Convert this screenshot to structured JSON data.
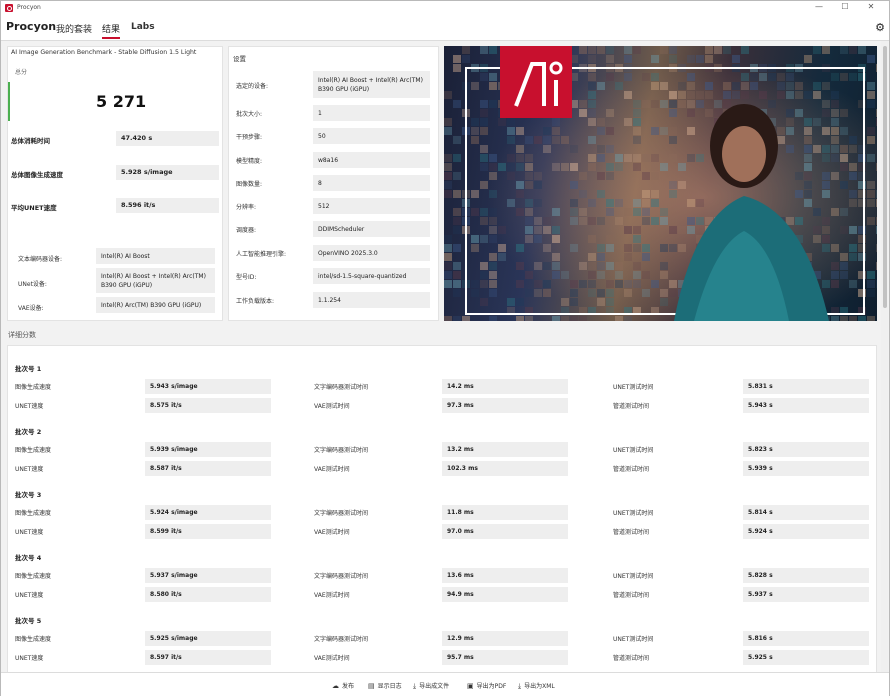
{
  "window": {
    "title": "Procyon",
    "controls": [
      "—",
      "☐",
      "✕"
    ]
  },
  "nav": {
    "brand": "Procyon",
    "tabs": [
      "我的套装",
      "结果",
      "Labs"
    ],
    "active_tab": "结果"
  },
  "summary": {
    "benchmark_name": "AI Image Generation Benchmark - Stable Diffusion 1.5 Light",
    "score_label": "总分",
    "score": "5 271",
    "metrics": [
      {
        "label": "总体消耗时间",
        "value": "47.420 s"
      },
      {
        "label": "总体图像生成速度",
        "value": "5.928 s/image"
      },
      {
        "label": "平均UNET速度",
        "value": "8.596 it/s"
      }
    ],
    "devices": [
      {
        "label": "文本编码器设备:",
        "value": "Intel(R) AI Boost"
      },
      {
        "label": "UNet设备:",
        "value": "Intel(R) AI Boost + Intel(R) Arc(TM) B390 GPU (iGPU)"
      },
      {
        "label": "VAE设备:",
        "value": "Intel(R) Arc(TM) B390 GPU (iGPU)"
      }
    ]
  },
  "settings": {
    "title": "设置",
    "rows": [
      {
        "label": "选定的设备:",
        "value": "Intel(R) AI Boost + Intel(R) Arc(TM) B390 GPU (iGPU)"
      },
      {
        "label": "批次大小:",
        "value": "1"
      },
      {
        "label": "干预步骤:",
        "value": "50"
      },
      {
        "label": "模型精度:",
        "value": "w8a16"
      },
      {
        "label": "图像数量:",
        "value": "8"
      },
      {
        "label": "分辨率:",
        "value": "512"
      },
      {
        "label": "调度器:",
        "value": "DDIMScheduler"
      },
      {
        "label": "人工智能推理引擎:",
        "value": "OpenVINO 2025.3.0"
      },
      {
        "label": "型号ID:",
        "value": "intel/sd-1.5-square-quantized"
      },
      {
        "label": "工作负载版本:",
        "value": "1.1.254"
      }
    ]
  },
  "hero": {
    "logo_text": "AI"
  },
  "detailed": {
    "title": "详细分数",
    "col_labels": [
      [
        "图像生成速度",
        "UNET速度"
      ],
      [
        "文字编码器测试时间",
        "VAE测试时间"
      ],
      [
        "UNET测试时间",
        "管道测试时间"
      ]
    ],
    "batches": [
      {
        "name": "批次号 1",
        "values": [
          "5.943 s/image",
          "8.575 it/s",
          "14.2 ms",
          "97.3 ms",
          "5.831 s",
          "5.943 s"
        ]
      },
      {
        "name": "批次号 2",
        "values": [
          "5.939 s/image",
          "8.587 it/s",
          "13.2 ms",
          "102.3 ms",
          "5.823 s",
          "5.939 s"
        ]
      },
      {
        "name": "批次号 3",
        "values": [
          "5.924 s/image",
          "8.599 it/s",
          "11.8 ms",
          "97.0 ms",
          "5.814 s",
          "5.924 s"
        ]
      },
      {
        "name": "批次号 4",
        "values": [
          "5.937 s/image",
          "8.580 it/s",
          "13.6 ms",
          "94.9 ms",
          "5.828 s",
          "5.937 s"
        ]
      },
      {
        "name": "批次号 5",
        "values": [
          "5.925 s/image",
          "8.597 it/s",
          "12.9 ms",
          "95.7 ms",
          "5.816 s",
          "5.925 s"
        ]
      }
    ]
  },
  "footer": {
    "buttons": [
      {
        "label": "发布",
        "icon": "cloud-icon"
      },
      {
        "label": "显示日志",
        "icon": "document-icon"
      },
      {
        "label": "导出成文件",
        "icon": "download-icon"
      },
      {
        "label": "导出为PDF",
        "icon": "save-icon"
      },
      {
        "label": "导出为XML",
        "icon": "download-icon"
      }
    ]
  },
  "colors": {
    "accent": "#c8102e",
    "score_bar": "#4caf50"
  }
}
